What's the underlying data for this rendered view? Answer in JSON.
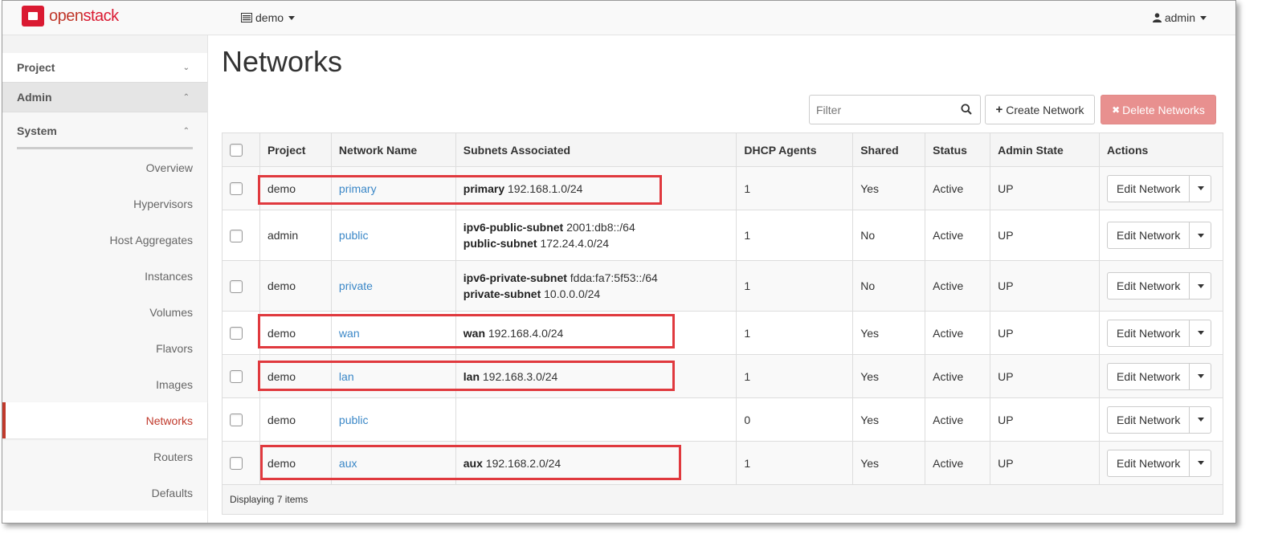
{
  "brand": {
    "name_open": "open",
    "name_stack": "stack"
  },
  "nav": {
    "project": "demo",
    "user": "admin"
  },
  "sidebar": {
    "panels": [
      {
        "label": "Project"
      },
      {
        "label": "Admin"
      }
    ],
    "group": "System",
    "items": [
      {
        "label": "Overview"
      },
      {
        "label": "Hypervisors"
      },
      {
        "label": "Host Aggregates"
      },
      {
        "label": "Instances"
      },
      {
        "label": "Volumes"
      },
      {
        "label": "Flavors"
      },
      {
        "label": "Images"
      },
      {
        "label": "Networks"
      },
      {
        "label": "Routers"
      },
      {
        "label": "Defaults"
      }
    ]
  },
  "page": {
    "title": "Networks",
    "filter_placeholder": "Filter",
    "create_label": "Create Network",
    "delete_label": "Delete Networks",
    "footer": "Displaying 7 items"
  },
  "table": {
    "headers": [
      "Project",
      "Network Name",
      "Subnets Associated",
      "DHCP Agents",
      "Shared",
      "Status",
      "Admin State",
      "Actions"
    ],
    "action_label": "Edit Network",
    "rows": [
      {
        "project": "demo",
        "name": "primary",
        "subnets": [
          {
            "name": "primary",
            "cidr": "192.168.1.0/24"
          }
        ],
        "dhcp": "1",
        "shared": "Yes",
        "status": "Active",
        "admin_state": "UP"
      },
      {
        "project": "admin",
        "name": "public",
        "subnets": [
          {
            "name": "ipv6-public-subnet",
            "cidr": "2001:db8::/64"
          },
          {
            "name": "public-subnet",
            "cidr": "172.24.4.0/24"
          }
        ],
        "dhcp": "1",
        "shared": "No",
        "status": "Active",
        "admin_state": "UP"
      },
      {
        "project": "demo",
        "name": "private",
        "subnets": [
          {
            "name": "ipv6-private-subnet",
            "cidr": "fdda:fa7:5f53::/64"
          },
          {
            "name": "private-subnet",
            "cidr": "10.0.0.0/24"
          }
        ],
        "dhcp": "1",
        "shared": "No",
        "status": "Active",
        "admin_state": "UP"
      },
      {
        "project": "demo",
        "name": "wan",
        "subnets": [
          {
            "name": "wan",
            "cidr": "192.168.4.0/24"
          }
        ],
        "dhcp": "1",
        "shared": "Yes",
        "status": "Active",
        "admin_state": "UP"
      },
      {
        "project": "demo",
        "name": "lan",
        "subnets": [
          {
            "name": "lan",
            "cidr": "192.168.3.0/24"
          }
        ],
        "dhcp": "1",
        "shared": "Yes",
        "status": "Active",
        "admin_state": "UP"
      },
      {
        "project": "demo",
        "name": "public",
        "subnets": [],
        "dhcp": "0",
        "shared": "Yes",
        "status": "Active",
        "admin_state": "UP"
      },
      {
        "project": "demo",
        "name": "aux",
        "subnets": [
          {
            "name": "aux",
            "cidr": "192.168.2.0/24"
          }
        ],
        "dhcp": "1",
        "shared": "Yes",
        "status": "Active",
        "admin_state": "UP"
      }
    ]
  },
  "colors": {
    "brand": "#da1a32",
    "link": "#3a87c7",
    "highlight": "#e0393e",
    "danger_button": "#e8908f"
  }
}
